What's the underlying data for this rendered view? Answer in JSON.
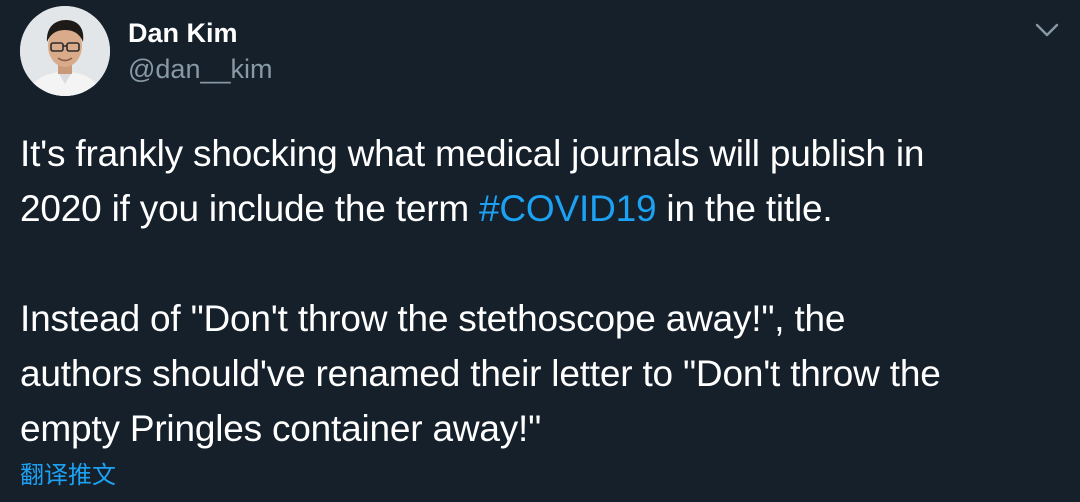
{
  "author": {
    "name": "Dan Kim",
    "handle": "@dan__kim"
  },
  "menu": {
    "icon": "chevron-down-icon"
  },
  "tweet": {
    "line1": "It's frankly shocking what medical journals will publish in",
    "line2_prefix": "2020 if you include the term ",
    "hashtag": "#COVID19",
    "line2_suffix": " in the title.",
    "line3": "Instead of \"Don't throw the stethoscope away!\", the",
    "line4": "authors should've renamed their letter to \"Don't throw the",
    "line5": "empty Pringles container away!\""
  },
  "translate_label": "翻译推文",
  "colors": {
    "background": "#15202b",
    "text": "#ffffff",
    "secondary": "#8899a6",
    "accent": "#1da1f2"
  }
}
